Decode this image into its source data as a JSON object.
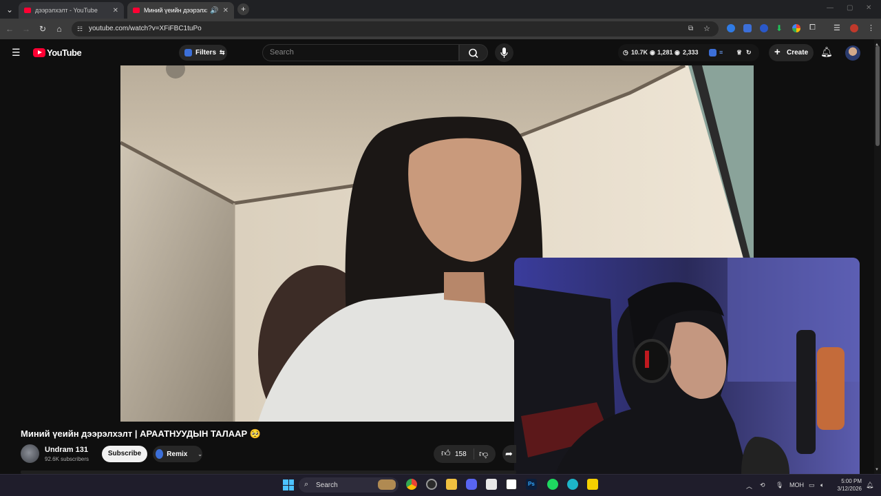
{
  "browser": {
    "tabs": [
      {
        "title": "дээрэлхэлт - YouTube",
        "active": false
      },
      {
        "title": "Миний үеийн дээрэлхэлт |",
        "active": true
      }
    ],
    "url": "youtube.com/watch?v=XFiFBC1tuPo"
  },
  "youtube": {
    "logo_text": "YouTube",
    "filters_label": "Filters",
    "search_placeholder": "Search",
    "stats": {
      "views": "10.7K",
      "likes": "1,281",
      "comments": "2,333"
    },
    "create_label": "Create"
  },
  "video": {
    "title": "Миний үеийн дээрэлхэлт | АРААТНУУДЫН ТАЛААР 🥺",
    "channel_name": "Undram 131",
    "subscribers": "92.6K subscribers",
    "subscribe_label": "Subscribe",
    "remix_label": "Remix",
    "like_count": "158"
  },
  "taskbar": {
    "search_label": "Search",
    "lang": "MOH",
    "time": "5:00 PM",
    "date": "3/12/2026"
  },
  "colors": {
    "brand": "#ff0033",
    "bg": "#0f0f0f",
    "taskbar": "#1f1d2b"
  }
}
